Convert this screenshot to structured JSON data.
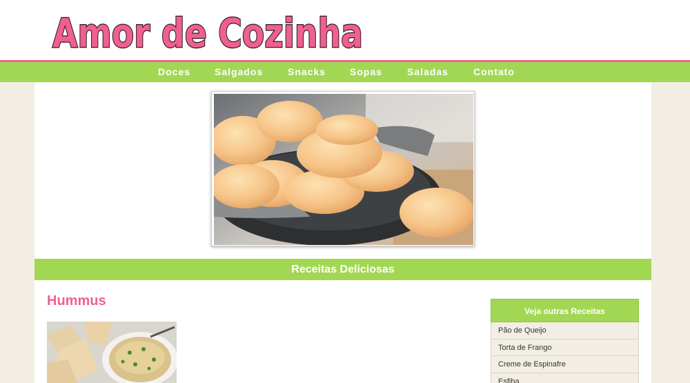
{
  "site": {
    "title": "Amor de Cozinha"
  },
  "nav": {
    "items": [
      {
        "label": "Doces"
      },
      {
        "label": "Salgados"
      },
      {
        "label": "Snacks"
      },
      {
        "label": "Sopas"
      },
      {
        "label": "Saladas"
      },
      {
        "label": "Contato"
      }
    ]
  },
  "hero": {
    "image": "cheese-bread-basket-photo"
  },
  "band": {
    "label": "Receitas Deliciosas"
  },
  "post": {
    "title": "Hummus",
    "image": "hummus-pita-photo"
  },
  "sidebar": {
    "heading": "Veja outras Receitas",
    "items": [
      {
        "label": "Pão de Queijo"
      },
      {
        "label": "Torta de Frango"
      },
      {
        "label": "Creme de Espinafre"
      },
      {
        "label": "Esfiha"
      }
    ]
  },
  "colors": {
    "accent_green": "#a2d754",
    "accent_pink": "#f0608f",
    "page_bg": "#f2eee3"
  }
}
